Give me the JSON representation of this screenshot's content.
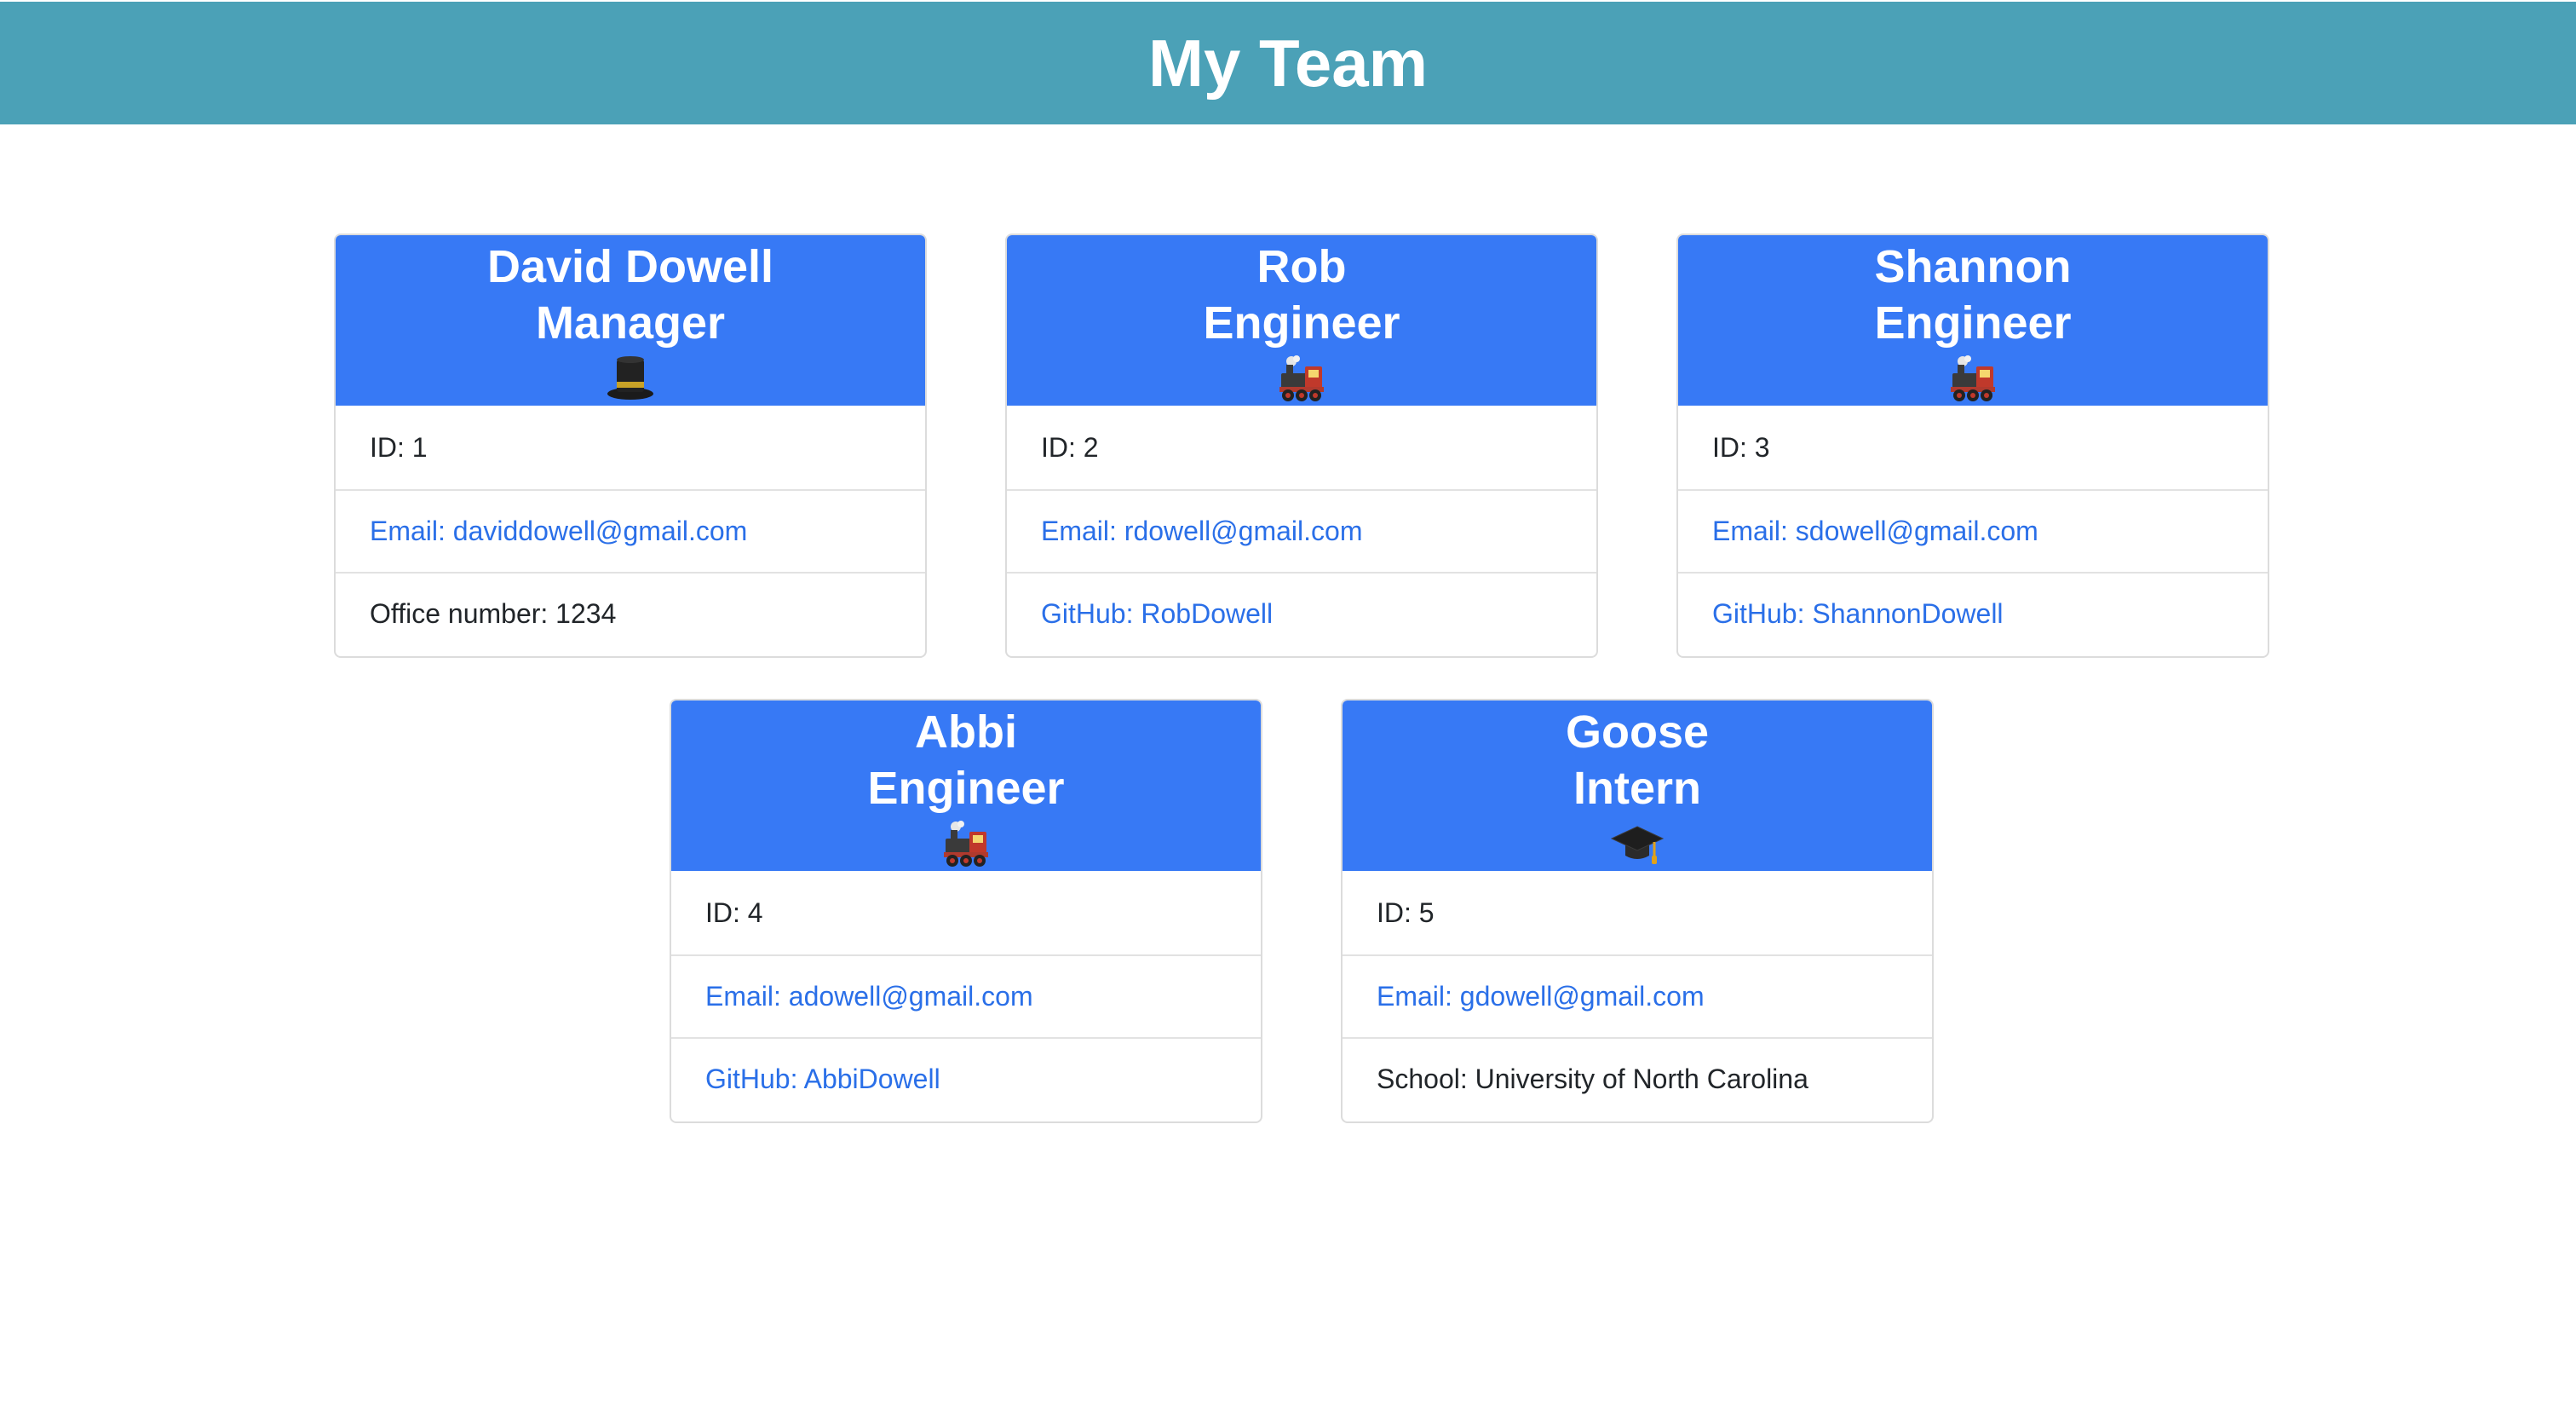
{
  "header": {
    "title": "My Team"
  },
  "cards": [
    {
      "name": "David Dowell",
      "role": "Manager",
      "icon": "top-hat-icon",
      "id_text": "ID: 1",
      "email_text": "Email: daviddowell@gmail.com",
      "extra_text": "Office number: 1234"
    },
    {
      "name": "Rob",
      "role": "Engineer",
      "icon": "locomotive-icon",
      "id_text": "ID: 2",
      "email_text": "Email: rdowell@gmail.com",
      "extra_text": "GitHub: RobDowell"
    },
    {
      "name": "Shannon",
      "role": "Engineer",
      "icon": "locomotive-icon",
      "id_text": "ID: 3",
      "email_text": "Email: sdowell@gmail.com",
      "extra_text": "GitHub: ShannonDowell"
    },
    {
      "name": "Abbi",
      "role": "Engineer",
      "icon": "locomotive-icon",
      "id_text": "ID: 4",
      "email_text": "Email: adowell@gmail.com",
      "extra_text": "GitHub: AbbiDowell"
    },
    {
      "name": "Goose",
      "role": "Intern",
      "icon": "graduation-cap-icon",
      "id_text": "ID: 5",
      "email_text": "Email: gdowell@gmail.com",
      "extra_text": "School: University of North Carolina"
    }
  ],
  "colors": {
    "header_bg": "#4ba1b7",
    "card_head_bg": "#3779f5",
    "link": "#2a6fe8"
  }
}
